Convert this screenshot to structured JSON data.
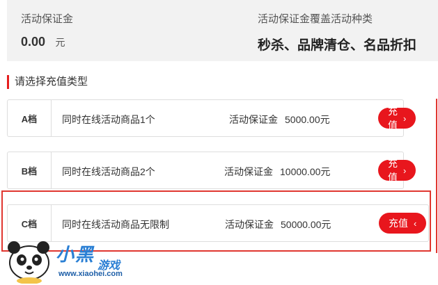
{
  "summary": {
    "deposit_label": "活动保证金",
    "amount": "0.00",
    "unit": "元",
    "coverage_label": "活动保证金覆盖活动种类",
    "coverage_types": "秒杀、品牌清仓、名品折扣"
  },
  "section_title": "请选择充值类型",
  "plans": [
    {
      "tier": "A档",
      "desc": "同时在线活动商品1个",
      "deposit_label": "活动保证金",
      "deposit_value": "5000.00元",
      "button": "充值",
      "chevron": "›"
    },
    {
      "tier": "B档",
      "desc": "同时在线活动商品2个",
      "deposit_label": "活动保证金",
      "deposit_value": "10000.00元",
      "button": "充值",
      "chevron": "›"
    },
    {
      "tier": "C档",
      "desc": "同时在线活动商品无限制",
      "deposit_label": "活动保证金",
      "deposit_value": "50000.00元",
      "button": "充值",
      "chevron": "‹"
    }
  ],
  "watermark": {
    "name": "小黑",
    "tag": "游戏",
    "url": "www.xiaohei.com"
  },
  "colors": {
    "accent": "#e8161d",
    "highlight_border": "#e0362f",
    "summary_bg": "#f2f2f2"
  }
}
